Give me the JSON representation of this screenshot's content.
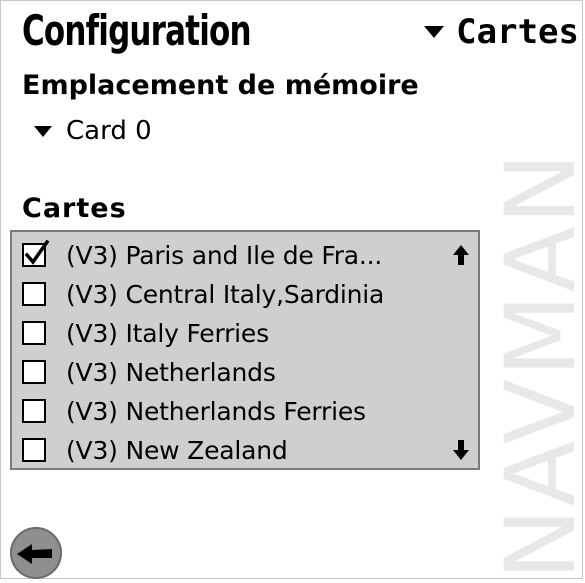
{
  "header": {
    "title": "Configuration",
    "category_select": "Cartes"
  },
  "memory": {
    "section_label": "Emplacement de mémoire",
    "selected": "Card 0"
  },
  "maps": {
    "section_label": "Cartes",
    "items": [
      {
        "label": "(V3) Paris and Ile de Fra...",
        "checked": true
      },
      {
        "label": "(V3) Central Italy,Sardinia",
        "checked": false
      },
      {
        "label": "(V3) Italy Ferries",
        "checked": false
      },
      {
        "label": "(V3) Netherlands",
        "checked": false
      },
      {
        "label": "(V3) Netherlands Ferries",
        "checked": false
      },
      {
        "label": "(V3) New Zealand",
        "checked": false
      }
    ]
  },
  "brand_watermark": "NAVMAN",
  "icons": {
    "scroll_up": "arrow-up-icon",
    "scroll_down": "arrow-down-icon",
    "back": "arrow-left-icon",
    "check": "checkmark-icon",
    "dropdown": "triangle-down-icon"
  },
  "colors": {
    "list_background": "#cfcfcf",
    "list_border": "#7a7a7a",
    "back_button": "#8f8f8f",
    "watermark": "#e8e8e8"
  }
}
